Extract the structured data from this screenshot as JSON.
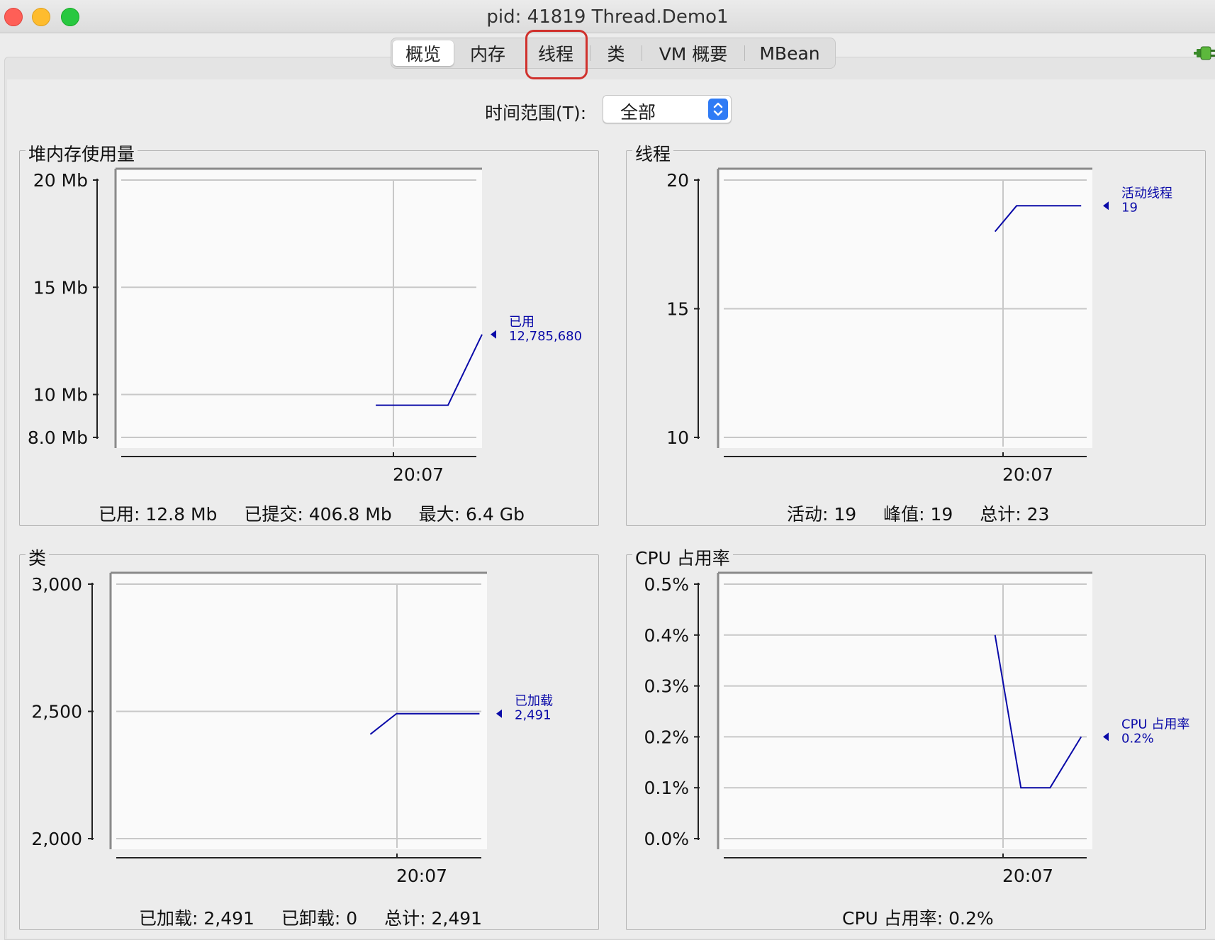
{
  "window": {
    "title": "pid: 41819 Thread.Demo1"
  },
  "tabs": [
    {
      "label": "概览",
      "selected": true
    },
    {
      "label": "内存",
      "selected": false
    },
    {
      "label": "线程",
      "selected": false,
      "highlighted": true
    },
    {
      "label": "类",
      "selected": false
    },
    {
      "label": "VM 概要",
      "selected": false
    },
    {
      "label": "MBean",
      "selected": false
    }
  ],
  "time_range": {
    "label": "时间范围(T):",
    "value": "全部"
  },
  "colors": {
    "series": "#0a0aa8",
    "highlight": "#d0312d",
    "window_bg": "#ececec"
  },
  "panels": {
    "heap": {
      "title": "堆内存使用量",
      "summary": [
        "已用: 12.8 Mb",
        "已提交: 406.8 Mb",
        "最大: 6.4 Gb"
      ]
    },
    "threads": {
      "title": "线程",
      "summary": [
        "活动: 19",
        "峰值: 19",
        "总计: 23"
      ]
    },
    "classes": {
      "title": "类",
      "summary": [
        "已加载: 2,491",
        "已卸载: 0",
        "总计: 2,491"
      ]
    },
    "cpu": {
      "title": "CPU 占用率",
      "summary": [
        "CPU 占用率: 0.2%"
      ]
    }
  },
  "chart_data": [
    {
      "type": "line",
      "panel": "heap",
      "title": "堆内存使用量",
      "y_unit": "Mb",
      "ylim": [
        8.0,
        20
      ],
      "yticks": [
        8.0,
        10,
        15,
        20
      ],
      "ytick_labels": [
        "8.0 Mb",
        "10 Mb",
        "15 Mb",
        "20 Mb"
      ],
      "xtick_labels": [
        "20:07"
      ],
      "grid": true,
      "series": [
        {
          "name": "已用",
          "value_label": "12,785,680",
          "x": [
            0.0,
            0.68,
            1.0
          ],
          "y": [
            9.5,
            9.5,
            12.8
          ]
        }
      ]
    },
    {
      "type": "line",
      "panel": "threads",
      "title": "线程",
      "ylim": [
        10,
        20
      ],
      "yticks": [
        10,
        15,
        20
      ],
      "ytick_labels": [
        "10",
        "15",
        "20"
      ],
      "xtick_labels": [
        "20:07"
      ],
      "grid": true,
      "series": [
        {
          "name": "活动线程",
          "value_label": "19",
          "x": [
            0.0,
            0.25,
            1.0
          ],
          "y": [
            18,
            19,
            19
          ]
        }
      ]
    },
    {
      "type": "line",
      "panel": "classes",
      "title": "类",
      "ylim": [
        2000,
        3000
      ],
      "yticks": [
        2000,
        2500,
        3000
      ],
      "ytick_labels": [
        "2,000",
        "2,500",
        "3,000"
      ],
      "xtick_labels": [
        "20:07"
      ],
      "grid": true,
      "series": [
        {
          "name": "已加载",
          "value_label": "2,491",
          "x": [
            0.0,
            0.24,
            1.0
          ],
          "y": [
            2410,
            2491,
            2491
          ]
        }
      ]
    },
    {
      "type": "line",
      "panel": "cpu",
      "title": "CPU 占用率",
      "ylim": [
        0.0,
        0.5
      ],
      "yticks": [
        0.0,
        0.1,
        0.2,
        0.3,
        0.4,
        0.5
      ],
      "ytick_labels": [
        "0.0%",
        "0.1%",
        "0.2%",
        "0.3%",
        "0.4%",
        "0.5%"
      ],
      "xtick_labels": [
        "20:07"
      ],
      "grid": true,
      "series": [
        {
          "name": "CPU 占用率",
          "value_label": "0.2%",
          "x": [
            0.0,
            0.3,
            0.64,
            1.0
          ],
          "y": [
            0.4,
            0.1,
            0.1,
            0.2
          ]
        }
      ]
    }
  ]
}
